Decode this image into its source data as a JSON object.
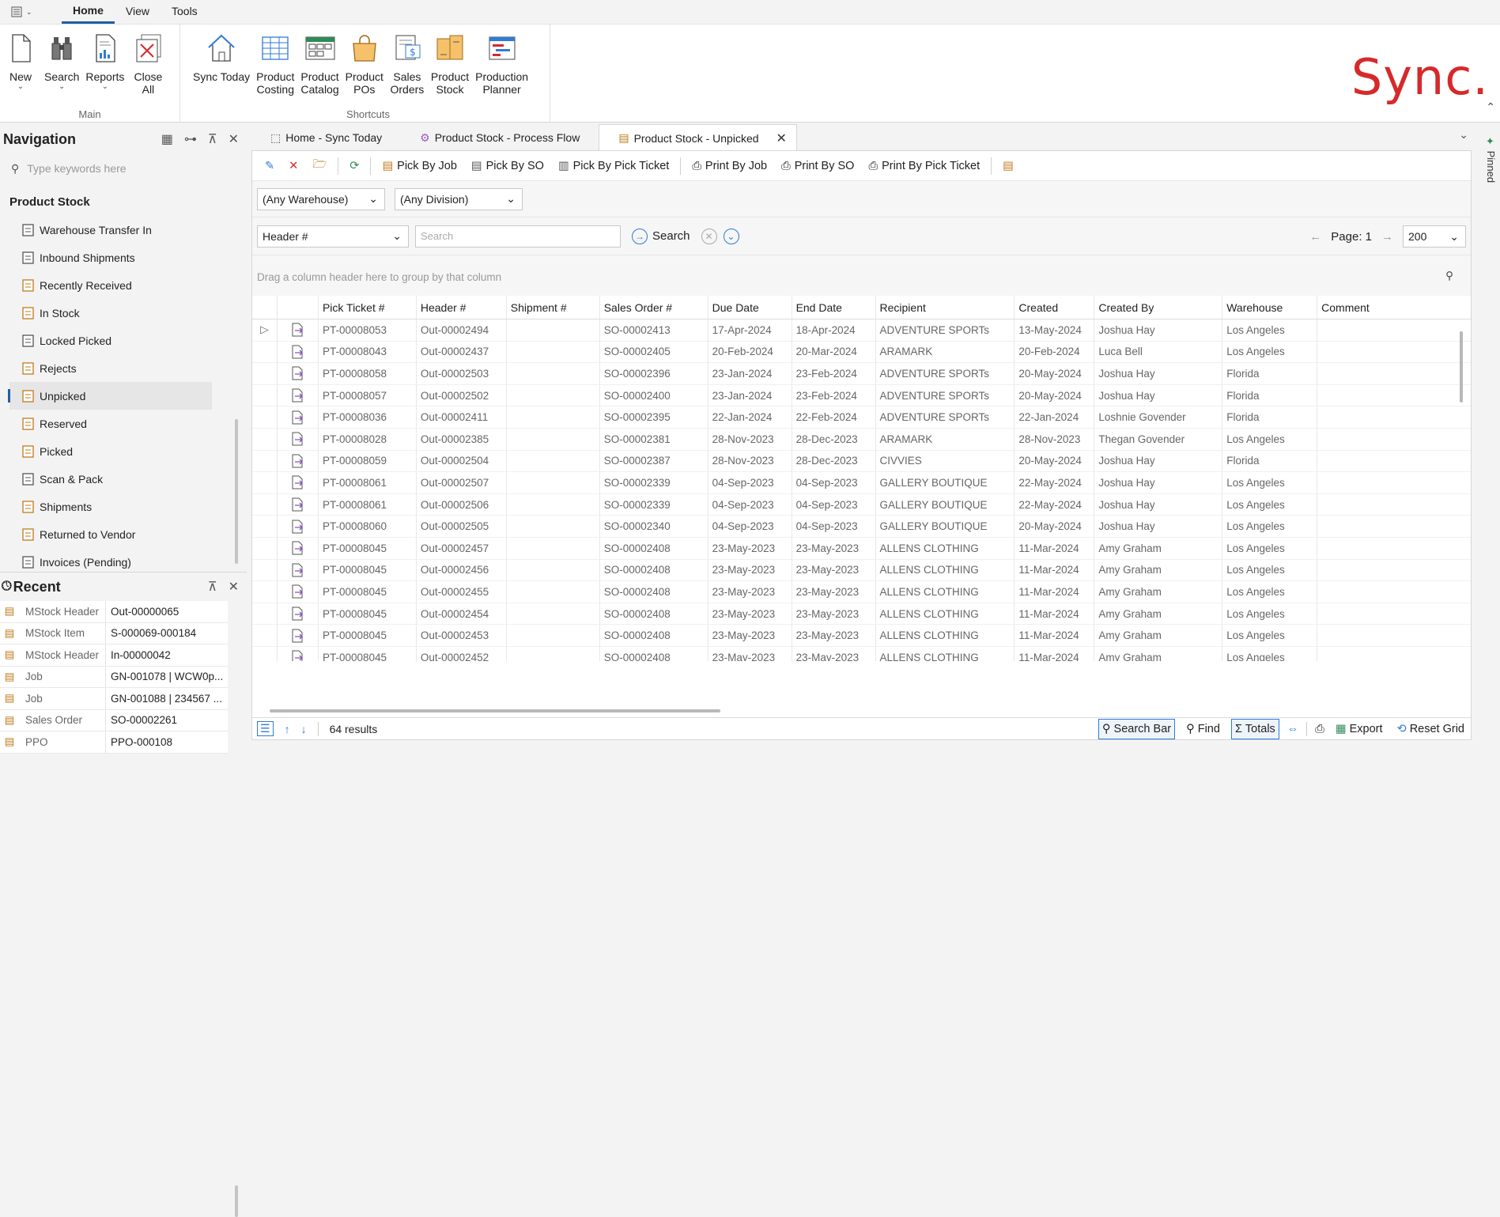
{
  "ribbon_tabs": [
    "Home",
    "View",
    "Tools"
  ],
  "ribbon": {
    "main_group": {
      "label": "Main",
      "buttons": [
        {
          "label": "New",
          "chev": "⌄"
        },
        {
          "label": "Search",
          "chev": "⌄"
        },
        {
          "label": "Reports",
          "chev": "⌄"
        },
        {
          "label": "Close\nAll",
          "l1": "Close",
          "l2": "All"
        }
      ]
    },
    "shortcuts_group": {
      "label": "Shortcuts",
      "buttons": [
        {
          "l1": "Sync Today",
          "l2": ""
        },
        {
          "l1": "Product",
          "l2": "Costing"
        },
        {
          "l1": "Product",
          "l2": "Catalog"
        },
        {
          "l1": "Product",
          "l2": "POs"
        },
        {
          "l1": "Sales",
          "l2": "Orders"
        },
        {
          "l1": "Product",
          "l2": "Stock"
        },
        {
          "l1": "Production",
          "l2": "Planner"
        }
      ]
    }
  },
  "brand": "Sync.",
  "navigation": {
    "title": "Navigation",
    "search_placeholder": "Type keywords here",
    "section": "Product Stock",
    "items": [
      "Warehouse Transfer In",
      "Inbound Shipments",
      "Recently Received",
      "In Stock",
      "Locked Picked",
      "Rejects",
      "Unpicked",
      "Reserved",
      "Picked",
      "Scan & Pack",
      "Shipments",
      "Returned to Vendor",
      "Invoices (Pending)"
    ],
    "selected": "Unpicked"
  },
  "recent": {
    "title": "Recent",
    "rows": [
      {
        "type": "MStock Header",
        "value": "Out-00000065"
      },
      {
        "type": "MStock Item",
        "value": "S-000069-000184"
      },
      {
        "type": "MStock Header",
        "value": "In-00000042"
      },
      {
        "type": "Job",
        "value": "GN-001078 | WCW0p..."
      },
      {
        "type": "Job",
        "value": "GN-001088 | 234567 ..."
      },
      {
        "type": "Sales Order",
        "value": "SO-00002261"
      },
      {
        "type": "PPO",
        "value": "PPO-000108"
      }
    ]
  },
  "doc_tabs": [
    "Home - Sync Today",
    "Product Stock - Process Flow",
    "Product Stock - Unpicked"
  ],
  "pinned_label": "Pinned",
  "toolbar": {
    "buttons": [
      "Pick By Job",
      "Pick By SO",
      "Pick By Pick Ticket",
      "Print By Job",
      "Print By SO",
      "Print By Pick Ticket"
    ]
  },
  "filters": {
    "warehouse": "(Any Warehouse)",
    "division": "(Any Division)"
  },
  "searchbar": {
    "field": "Header #",
    "placeholder": "Search",
    "search_label": "Search",
    "page_label": "Page: 1",
    "page_size": "200"
  },
  "group_panel_text": "Drag a column header here to group by that column",
  "grid": {
    "columns": [
      "Pick Ticket #",
      "Header #",
      "Shipment #",
      "Sales Order #",
      "Due Date",
      "End Date",
      "Recipient",
      "Created",
      "Created By",
      "Warehouse",
      "Comment"
    ],
    "rows": [
      [
        "PT-00008053",
        "Out-00002494",
        "",
        "SO-00002413",
        "17-Apr-2024",
        "18-Apr-2024",
        "ADVENTURE SPORTs",
        "13-May-2024",
        "Joshua Hay",
        "Los Angeles",
        ""
      ],
      [
        "PT-00008043",
        "Out-00002437",
        "",
        "SO-00002405",
        "20-Feb-2024",
        "20-Mar-2024",
        "ARAMARK",
        "20-Feb-2024",
        "Luca Bell",
        "Los Angeles",
        ""
      ],
      [
        "PT-00008058",
        "Out-00002503",
        "",
        "SO-00002396",
        "23-Jan-2024",
        "23-Feb-2024",
        "ADVENTURE SPORTs",
        "20-May-2024",
        "Joshua Hay",
        "Florida",
        ""
      ],
      [
        "PT-00008057",
        "Out-00002502",
        "",
        "SO-00002400",
        "23-Jan-2024",
        "23-Feb-2024",
        "ADVENTURE SPORTs",
        "20-May-2024",
        "Joshua Hay",
        "Florida",
        ""
      ],
      [
        "PT-00008036",
        "Out-00002411",
        "",
        "SO-00002395",
        "22-Jan-2024",
        "22-Feb-2024",
        "ADVENTURE SPORTs",
        "22-Jan-2024",
        "Loshnie Govender",
        "Florida",
        ""
      ],
      [
        "PT-00008028",
        "Out-00002385",
        "",
        "SO-00002381",
        "28-Nov-2023",
        "28-Dec-2023",
        "ARAMARK",
        "28-Nov-2023",
        "Thegan Govender",
        "Los Angeles",
        ""
      ],
      [
        "PT-00008059",
        "Out-00002504",
        "",
        "SO-00002387",
        "28-Nov-2023",
        "28-Dec-2023",
        "CIVVIES",
        "20-May-2024",
        "Joshua Hay",
        "Florida",
        ""
      ],
      [
        "PT-00008061",
        "Out-00002507",
        "",
        "SO-00002339",
        "04-Sep-2023",
        "04-Sep-2023",
        "GALLERY BOUTIQUE",
        "22-May-2024",
        "Joshua Hay",
        "Los Angeles",
        ""
      ],
      [
        "PT-00008061",
        "Out-00002506",
        "",
        "SO-00002339",
        "04-Sep-2023",
        "04-Sep-2023",
        "GALLERY BOUTIQUE",
        "22-May-2024",
        "Joshua Hay",
        "Los Angeles",
        ""
      ],
      [
        "PT-00008060",
        "Out-00002505",
        "",
        "SO-00002340",
        "04-Sep-2023",
        "04-Sep-2023",
        "GALLERY BOUTIQUE",
        "20-May-2024",
        "Joshua Hay",
        "Los Angeles",
        ""
      ],
      [
        "PT-00008045",
        "Out-00002457",
        "",
        "SO-00002408",
        "23-May-2023",
        "23-May-2023",
        "ALLENS CLOTHING",
        "11-Mar-2024",
        "Amy Graham",
        "Los Angeles",
        ""
      ],
      [
        "PT-00008045",
        "Out-00002456",
        "",
        "SO-00002408",
        "23-May-2023",
        "23-May-2023",
        "ALLENS CLOTHING",
        "11-Mar-2024",
        "Amy Graham",
        "Los Angeles",
        ""
      ],
      [
        "PT-00008045",
        "Out-00002455",
        "",
        "SO-00002408",
        "23-May-2023",
        "23-May-2023",
        "ALLENS CLOTHING",
        "11-Mar-2024",
        "Amy Graham",
        "Los Angeles",
        ""
      ],
      [
        "PT-00008045",
        "Out-00002454",
        "",
        "SO-00002408",
        "23-May-2023",
        "23-May-2023",
        "ALLENS CLOTHING",
        "11-Mar-2024",
        "Amy Graham",
        "Los Angeles",
        ""
      ],
      [
        "PT-00008045",
        "Out-00002453",
        "",
        "SO-00002408",
        "23-May-2023",
        "23-May-2023",
        "ALLENS CLOTHING",
        "11-Mar-2024",
        "Amy Graham",
        "Los Angeles",
        ""
      ],
      [
        "PT-00008045",
        "Out-00002452",
        "",
        "SO-00002408",
        "23-May-2023",
        "23-May-2023",
        "ALLENS CLOTHING",
        "11-Mar-2024",
        "Amy Graham",
        "Los Angeles",
        ""
      ]
    ]
  },
  "status": {
    "results": "64 results",
    "buttons": [
      "Search Bar",
      "Find",
      "Totals",
      "Export",
      "Reset Grid"
    ]
  },
  "colors": {
    "accent": "#1f5fa8",
    "brand": "#d62a2a",
    "icon_orange": "#c07a1c"
  }
}
